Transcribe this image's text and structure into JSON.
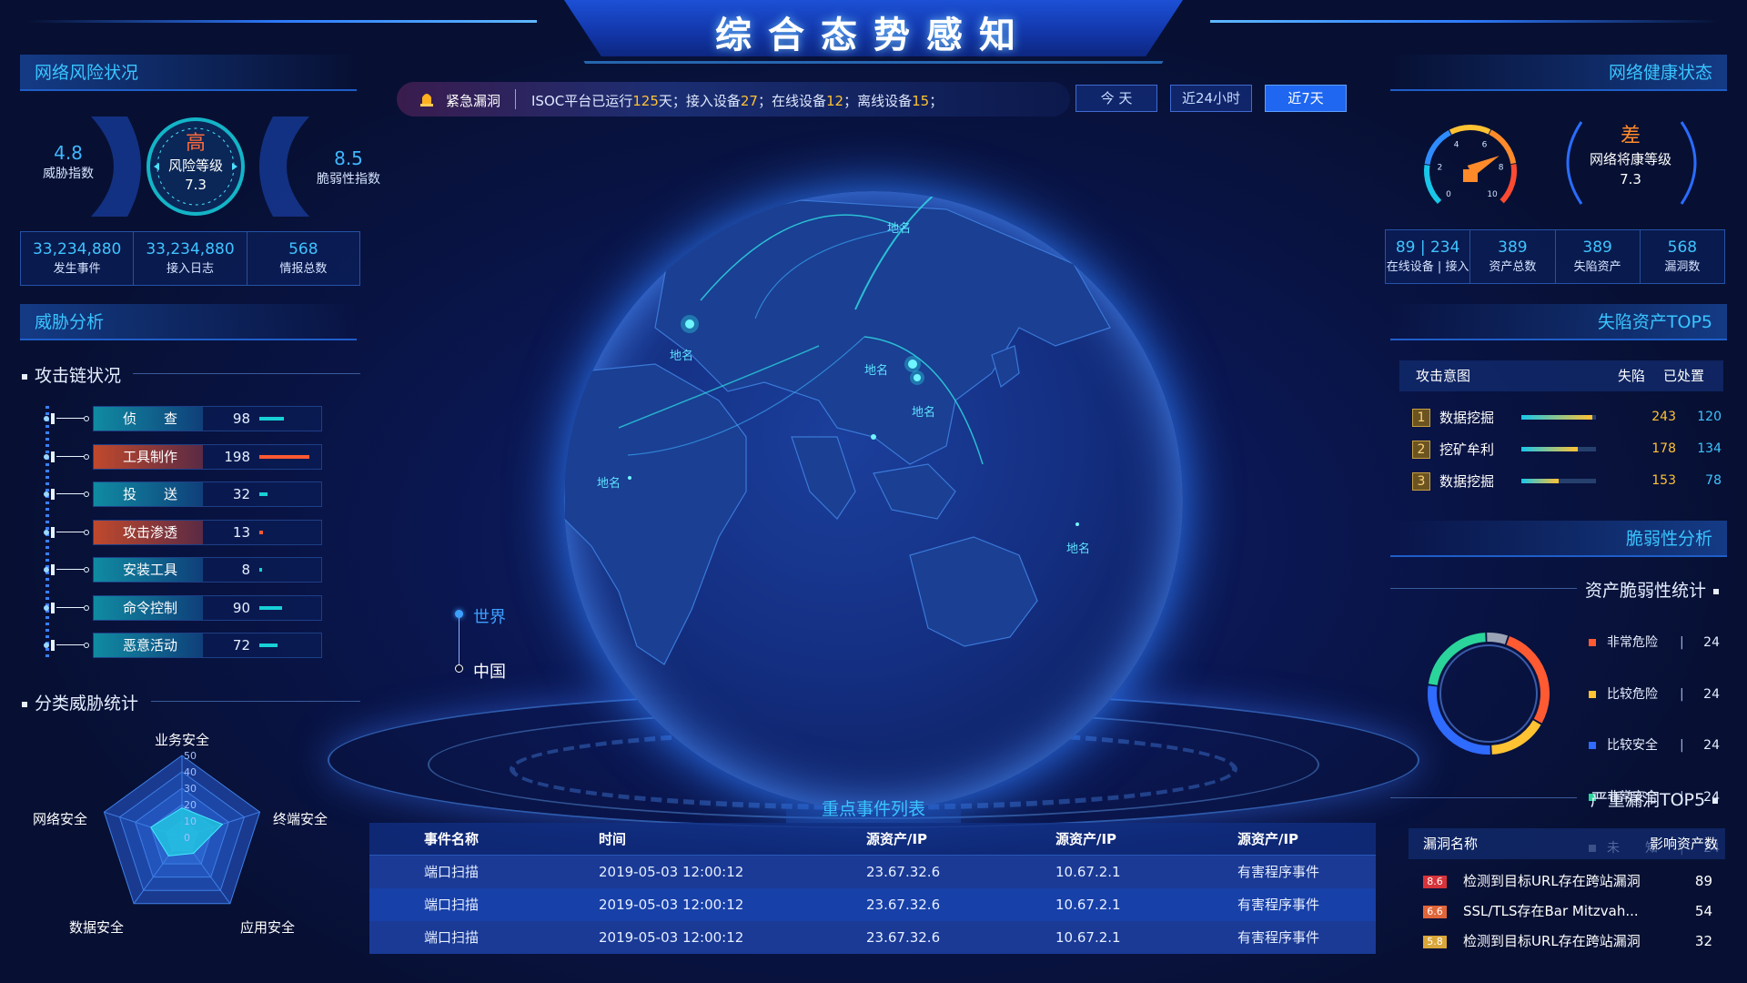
{
  "header": {
    "title": "综合态势感知"
  },
  "left": {
    "risk_section": "网络风险状况",
    "threat_index": {
      "value": "4.8",
      "label": "威胁指数"
    },
    "risk_level": {
      "level": "高",
      "label": "风险等级",
      "value": "7.3"
    },
    "vuln_index": {
      "value": "8.5",
      "label": "脆弱性指数"
    },
    "stats": [
      {
        "value": "33,234,880",
        "label": "发生事件"
      },
      {
        "value": "33,234,880",
        "label": "接入日志"
      },
      {
        "value": "568",
        "label": "情报总数"
      }
    ],
    "threat_section": "威胁分析",
    "chain_title": "攻击链状况",
    "chain": [
      {
        "label": "侦　　查",
        "value": 98,
        "hot": false
      },
      {
        "label": "工具制作",
        "value": 198,
        "hot": true
      },
      {
        "label": "投　　送",
        "value": 32,
        "hot": false
      },
      {
        "label": "攻击渗透",
        "value": 13,
        "hot": true
      },
      {
        "label": "安装工具",
        "value": 8,
        "hot": false
      },
      {
        "label": "命令控制",
        "value": 90,
        "hot": false
      },
      {
        "label": "恶意活动",
        "value": 72,
        "hot": false
      }
    ],
    "category_title": "分类威胁统计",
    "radar": {
      "axes": [
        "业务安全",
        "终端安全",
        "应用安全",
        "数据安全",
        "网络安全"
      ],
      "ticks": [
        "50",
        "40",
        "30",
        "20",
        "10",
        "0"
      ],
      "values": [
        18,
        26,
        12,
        14,
        20
      ]
    }
  },
  "center": {
    "alert_label": "紧急漏洞",
    "ticker": {
      "prefix": "ISOC平台已运行",
      "days": "125",
      "t1": "天；接入设备",
      "devices": "27",
      "t2": "；在线设备",
      "online": "12",
      "t3": "；离线设备",
      "offline": "15",
      "t4": "；"
    },
    "range_buttons": [
      {
        "label": "今 天",
        "active": false
      },
      {
        "label": "近24小时",
        "active": false
      },
      {
        "label": "近7天",
        "active": true
      }
    ],
    "place_label": "地名",
    "scope": [
      "世界",
      "中国"
    ],
    "events_title": "重点事件列表",
    "events_columns": [
      "事件名称",
      "时间",
      "源资产/IP",
      "源资产/IP",
      "源资产/IP"
    ],
    "events": [
      [
        "端口扫描",
        "2019-05-03  12:00:12",
        "23.67.32.6",
        "10.67.2.1",
        "有害程序事件"
      ],
      [
        "端口扫描",
        "2019-05-03  12:00:12",
        "23.67.32.6",
        "10.67.2.1",
        "有害程序事件"
      ],
      [
        "端口扫描",
        "2019-05-03  12:00:12",
        "23.67.32.6",
        "10.67.2.1",
        "有害程序事件"
      ]
    ]
  },
  "right": {
    "health_section": "网络健康状态",
    "gauge_ticks": [
      "0",
      "2",
      "4",
      "6",
      "8",
      "10"
    ],
    "gauge_value": 7.3,
    "health_level": {
      "level": "差",
      "label": "网络将康等级",
      "value": "7.3"
    },
    "stats": [
      {
        "value": "89 | 234",
        "label": "在线设备 | 接入"
      },
      {
        "value": "389",
        "label": "资产总数"
      },
      {
        "value": "389",
        "label": "失陷资产"
      },
      {
        "value": "568",
        "label": "漏洞数"
      }
    ],
    "fallen_section": "失陷资产TOP5",
    "fallen_columns": [
      "攻击意图",
      "失陷",
      "已处置"
    ],
    "fallen": [
      {
        "rank": "1",
        "name": "数据挖掘",
        "lost": "243",
        "handled": "120",
        "fill": 0.95
      },
      {
        "rank": "2",
        "name": "挖矿牟利",
        "lost": "178",
        "handled": "134",
        "fill": 0.75
      },
      {
        "rank": "3",
        "name": "数据挖掘",
        "lost": "153",
        "handled": "78",
        "fill": 0.5
      }
    ],
    "vuln_section": "脆弱性分析",
    "asset_vuln_title": "资产脆弱性统计",
    "legend": [
      {
        "label": "非常危险",
        "count": "24",
        "color": "#ff5a32"
      },
      {
        "label": "比较危险",
        "count": "24",
        "color": "#ffc233"
      },
      {
        "label": "比较安全",
        "count": "24",
        "color": "#2f6bff"
      },
      {
        "label": "非常安全",
        "count": "24",
        "color": "#2bd49a"
      },
      {
        "label": "未　　知",
        "count": "24",
        "color": "#9aa3b5"
      }
    ],
    "severe_title": "严重漏洞TOP5",
    "severe_columns": [
      "漏洞名称",
      "影响资产数"
    ],
    "severe": [
      {
        "score": "8.6",
        "name": "检测到目标URL存在跨站漏洞",
        "count": "89",
        "color": "#d6343a"
      },
      {
        "score": "6.6",
        "name": "SSL/TLS存在Bar Mitzvah...",
        "count": "54",
        "color": "#e0663a"
      },
      {
        "score": "5.8",
        "name": "检测到目标URL存在跨站漏洞",
        "count": "32",
        "color": "#d9a63a"
      }
    ]
  }
}
